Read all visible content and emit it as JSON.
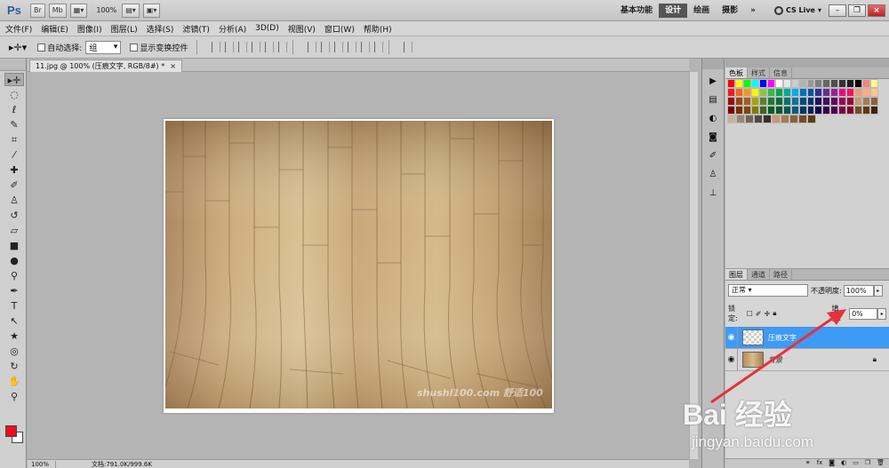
{
  "titlebar": {
    "app_logo": "Ps",
    "buttons": [
      "Br",
      "Mb"
    ],
    "zoom": "100%",
    "workspaces": [
      "基本功能",
      "设计",
      "绘画",
      "摄影"
    ],
    "active_workspace": "设计",
    "more": "»",
    "cs_live": "CS Live"
  },
  "menu": [
    "文件(F)",
    "编辑(E)",
    "图像(I)",
    "图层(L)",
    "选择(S)",
    "滤镜(T)",
    "分析(A)",
    "3D(D)",
    "视图(V)",
    "窗口(W)",
    "帮助(H)"
  ],
  "options": {
    "auto_select_label": "自动选择:",
    "auto_select_value": "组",
    "transform_label": "显示变换控件"
  },
  "document": {
    "tab_title": "11.jpg @ 100% (压痕文字, RGB/8#) *",
    "tab_close": "×",
    "image_watermark": "shushi100.com 舒适100",
    "status_zoom": "100%",
    "status_info": "文档:791.0K/999.6K"
  },
  "panels": {
    "top_tabs": [
      "色板",
      "样式",
      "信息"
    ],
    "layer_tabs": [
      "图层",
      "通道",
      "路径"
    ],
    "blend_mode": "正常",
    "opacity_label": "不透明度:",
    "opacity_value": "100%",
    "lock_label": "锁定:",
    "fill_label": "填充:",
    "fill_value": "0%",
    "layers": [
      {
        "name": "压痕文字",
        "selected": true
      },
      {
        "name": "背景",
        "selected": false
      }
    ]
  },
  "colors": {
    "foreground": "#e8101b",
    "background": "#ffffff",
    "selected_layer": "#3d9af5",
    "annotation_arrow": "#e8303a"
  },
  "watermark": {
    "main": "Bai 经验",
    "sub": "jingyan.baidu.com"
  }
}
